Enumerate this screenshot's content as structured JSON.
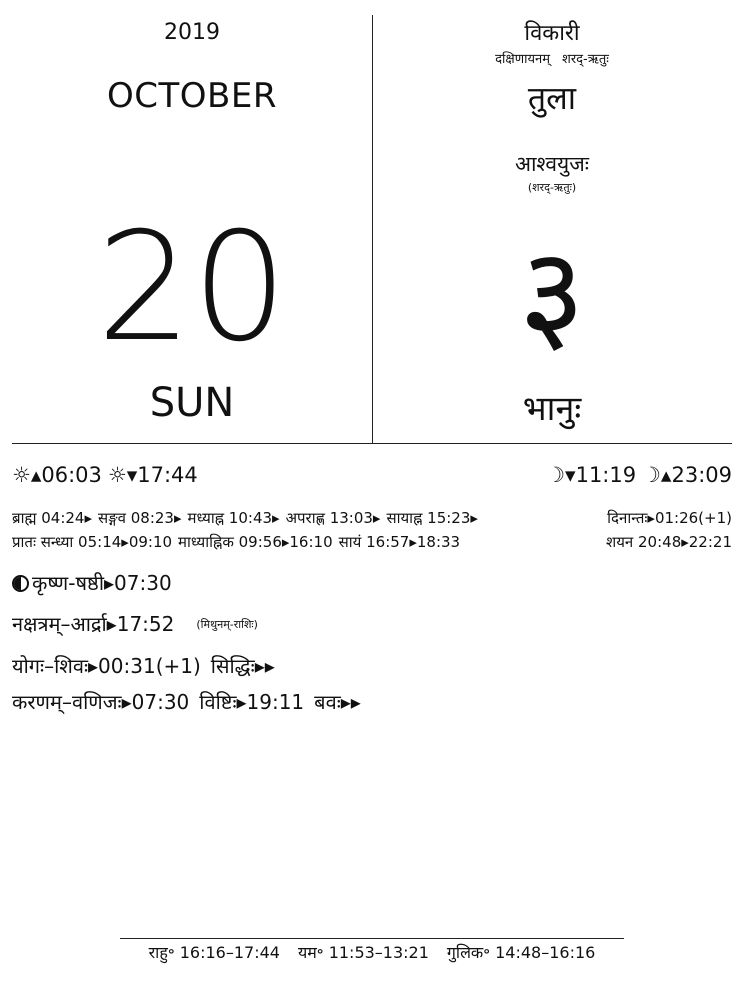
{
  "gregorian": {
    "year": "2019",
    "month": "OCTOBER",
    "day": "20",
    "weekday": "SUN"
  },
  "hindu": {
    "samvatsara": "विकारी",
    "ayana": "दक्षिणायनम्",
    "ritu": "शरद्-ऋतुः",
    "rashi": "तुला",
    "masa": "आश्वयुजः",
    "masa_ritu": "(शरद्-ऋतुः)",
    "tithi_number": "३",
    "vara": "भानुः"
  },
  "sun": {
    "sunrise": "☼▴06:03",
    "sunset": "☼▾17:44"
  },
  "moon": {
    "moonset": "☽▾11:19",
    "moonrise": "☽▴23:09"
  },
  "muhurta": {
    "line1": [
      "ब्राह्म 04:24▸",
      "सङ्गव 08:23▸",
      "मध्याह्न 10:43▸",
      "अपराह्ण 13:03▸",
      "सायाह्न 15:23▸"
    ],
    "dinanta": "दिनान्तः▸01:26(+1)",
    "line2": [
      "प्रातः सन्ध्या 05:14▸09:10",
      "माध्याह्निक 09:56▸16:10",
      "सायं 16:57▸18:33"
    ],
    "shayana": "शयन 20:48▸22:21"
  },
  "panchanga": {
    "tithi": "कृष्ण-षष्ठी▸07:30",
    "nakshatra": "नक्षत्रम्–आर्द्रा▸17:52",
    "nakshatra_rashi": "(मिथुनम्-राशिः)",
    "yoga": "योगः–शिवः▸00:31(+1)",
    "yoga_next": "सिद्धिः▸▸",
    "karana": "करणम्–वणिजः▸07:30",
    "karana_next1": "विष्टिः▸19:11",
    "karana_next2": "बवः▸▸"
  },
  "footer": {
    "rahu": "राहु॰ 16:16–17:44",
    "yama": "यम॰ 11:53–13:21",
    "gulika": "गुलिक॰ 14:48–16:16"
  }
}
